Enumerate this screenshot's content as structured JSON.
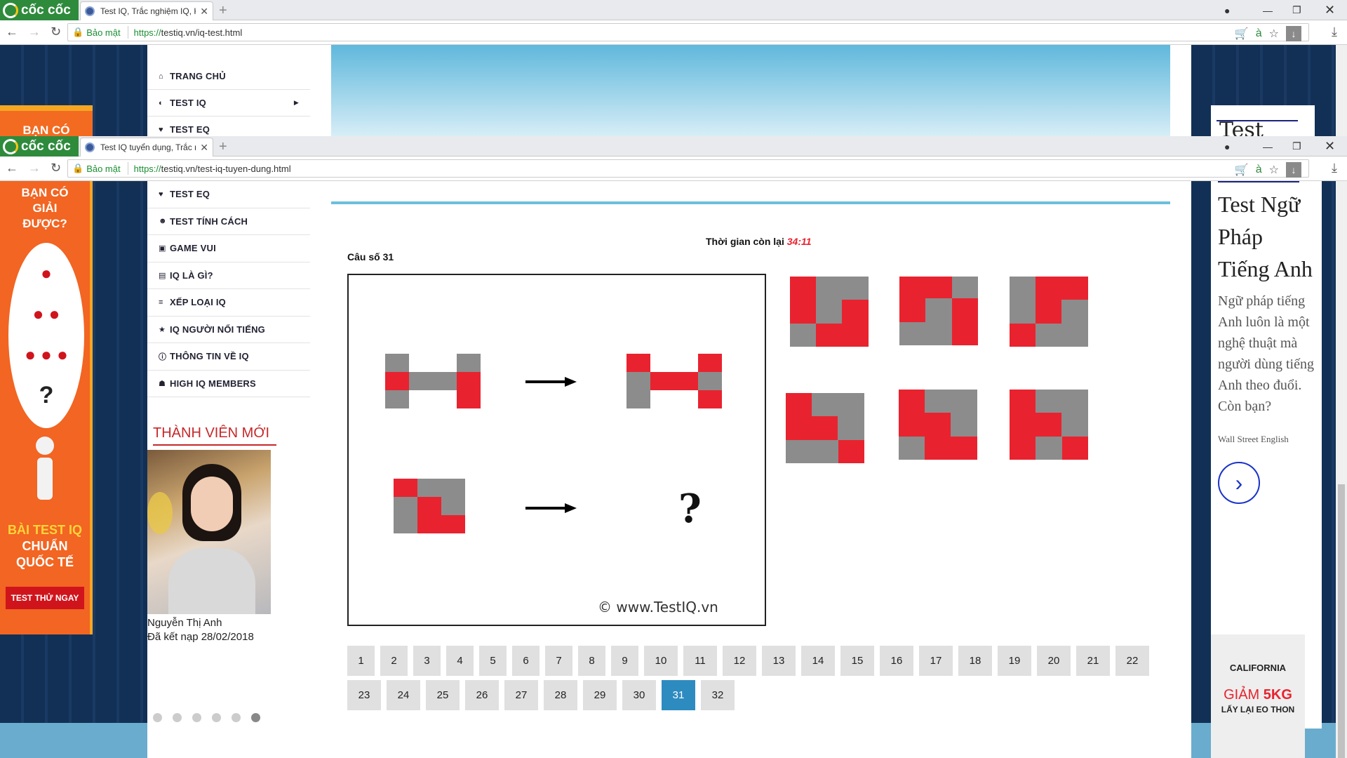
{
  "browser": {
    "logo_text": "cốc cốc",
    "back_window": {
      "tab_title": "Test IQ, Trắc nghiệm IQ, Ki",
      "secure_label": "Bảo mật",
      "url_scheme": "https://",
      "url_rest": "testiq.vn/iq-test.html"
    },
    "front_window": {
      "tab_title": "Test IQ tuyển dụng, Trắc n",
      "secure_label": "Bảo mật",
      "url_scheme": "https://",
      "url_rest": "testiq.vn/test-iq-tuyen-dung.html"
    }
  },
  "back_menu": [
    "TRANG CHỦ",
    "TEST IQ",
    "TEST EQ"
  ],
  "back_ad_peek": "Test Ngữ",
  "menu": [
    {
      "label": "TEST EQ",
      "icon": "heart-icon"
    },
    {
      "label": "TEST TÍNH CÁCH",
      "icon": "users-icon"
    },
    {
      "label": "GAME VUI",
      "icon": "gamepad-icon"
    },
    {
      "label": "IQ LÀ GÌ?",
      "icon": "book-icon"
    },
    {
      "label": "XẾP LOẠI IQ",
      "icon": "list-icon"
    },
    {
      "label": "IQ NGƯỜI NỔI TIẾNG",
      "icon": "star-icon"
    },
    {
      "label": "THÔNG TIN VỀ IQ",
      "icon": "info-icon"
    },
    {
      "label": "HIGH IQ MEMBERS",
      "icon": "group-icon"
    }
  ],
  "new_member": {
    "heading": "THÀNH VIÊN MỚI",
    "name": "Nguyễn Thị Anh",
    "joined": "Đã kết nạp 28/02/2018",
    "dots": 6,
    "active_dot": 6
  },
  "left_ad": {
    "top_text": [
      "BẠN CÓ",
      "GIẢI",
      "ĐƯỢC?"
    ],
    "bottom_text": [
      "BÀI TEST IQ",
      "CHUẨN",
      "QUỐC TẾ"
    ],
    "button": "TEST THỬ NGAY"
  },
  "quiz": {
    "timer_label": "Thời gian còn lại",
    "timer_value": "34:11",
    "question_label": "Câu số 31",
    "watermark": "© www.TestIQ.vn",
    "question_mark": "?",
    "pages": [
      "1",
      "2",
      "3",
      "4",
      "5",
      "6",
      "7",
      "8",
      "9",
      "10",
      "11",
      "12",
      "13",
      "14",
      "15",
      "16",
      "17",
      "18",
      "19",
      "20",
      "21",
      "22",
      "23",
      "24",
      "25",
      "26",
      "27",
      "28",
      "29",
      "30",
      "31",
      "32"
    ],
    "current_page": "31"
  },
  "right_ad": {
    "title": "Test Ngữ Pháp Tiếng Anh",
    "body": "Ngữ pháp tiếng Anh luôn là một nghệ thuật mà người dùng tiếng Anh theo đuổi. Còn bạn?",
    "sponsor": "Wall Street English"
  },
  "right_ad2": {
    "brand": "CALIFORNIA",
    "line1_a": "GIẢM ",
    "line1_b": "5KG",
    "line2": "LẤY LẠI EO THON"
  },
  "colors": {
    "red": "#e8232f",
    "gray": "#8c8c8c",
    "active_page": "#2e8bc0",
    "accent_line": "#6cbfdc"
  }
}
